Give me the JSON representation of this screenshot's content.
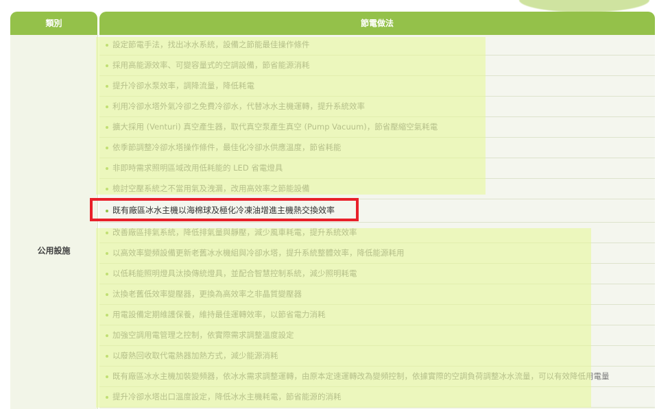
{
  "table": {
    "header_category": "類別",
    "header_method": "節電做法",
    "category": "公用設施",
    "rows": [
      "設定節電手法，找出冰水系統，設備之節能最佳操作條件",
      "採用高能源效率、可變容量式的空調設備，節省能源消耗",
      "提升冷卻水泵效率，調降流量，降低耗電",
      "利用冷卻水塔外氣冷卻之免費冷卻水，代替冰水主機運轉，提升系統效率",
      "擴大採用 (Venturi) 真空產生器，取代真空泵產生真空 (Pump Vacuum)，節省壓縮空氣耗電",
      "依季節調整冷卻水塔操作條件，最佳化冷卻水供應溫度，節省耗能",
      "非即時需求照明區域改用低耗能的 LED 省電燈具",
      "檢討空壓系統之不當用氣及洩漏，改用高效率之節能設備",
      "既有廠區冰水主機以海棉球及極化冷凍油增進主機熱交換效率",
      "改善廠區排氣系統，降低排氣量與靜壓，減少風車耗電，提升系統效率",
      "以高效率變頻設備更新老舊冰水機組與冷卻水塔，提升系統整體效率，降低能源耗用",
      "以低耗能照明燈具汰換傳統燈具，並配合智慧控制系統，減少照明耗電",
      "汰換老舊低效率變壓器，更換為高效率之非晶質變壓器",
      "用電設備定期維護保養，維持最佳運轉效率，以節省電力消耗",
      "加強空調用電管理之控制，依實際需求調整溫度設定",
      "以廢熱回收取代電熱器加熱方式，減少能源消耗",
      "既有廠區冰水主機加裝變頻器，依冰水需求調整運轉，由原本定速運轉改為變頻控制，依據實際的空調負荷調整冰水流量，可以有效降低用電量",
      "提升冷卻水塔出口溫度設定，降低冰水主機耗電，節省能源的消耗"
    ]
  }
}
